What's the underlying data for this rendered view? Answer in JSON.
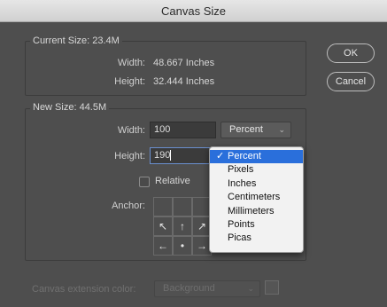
{
  "window": {
    "title": "Canvas Size"
  },
  "current": {
    "label": "Current Size: 23.4M",
    "width_label": "Width:",
    "width_value": "48.667 Inches",
    "height_label": "Height:",
    "height_value": "32.444 Inches"
  },
  "new_size": {
    "label": "New Size: 44.5M",
    "width_label": "Width:",
    "width_value": "100",
    "width_unit": "Percent",
    "height_label": "Height:",
    "height_value": "190",
    "relative_label": "Relative",
    "relative_checked": false,
    "anchor_label": "Anchor:"
  },
  "buttons": {
    "ok": "OK",
    "cancel": "Cancel"
  },
  "unit_menu": {
    "selected": "Percent",
    "check": "✓",
    "items": [
      "Percent",
      "Pixels",
      "Inches",
      "Centimeters",
      "Millimeters",
      "Points",
      "Picas"
    ]
  },
  "extension": {
    "label": "Canvas extension color:",
    "value": "Background"
  },
  "icons": {
    "arrow_nw": "↖",
    "arrow_n": "↑",
    "arrow_ne": "↗",
    "arrow_w": "←",
    "center": "•",
    "arrow_e": "→",
    "chevron_down": "⌄"
  },
  "colors": {
    "dialog_bg": "#4e4e4e",
    "menu_selected": "#2a6fdb",
    "menu_bg": "#f2f2f2"
  }
}
